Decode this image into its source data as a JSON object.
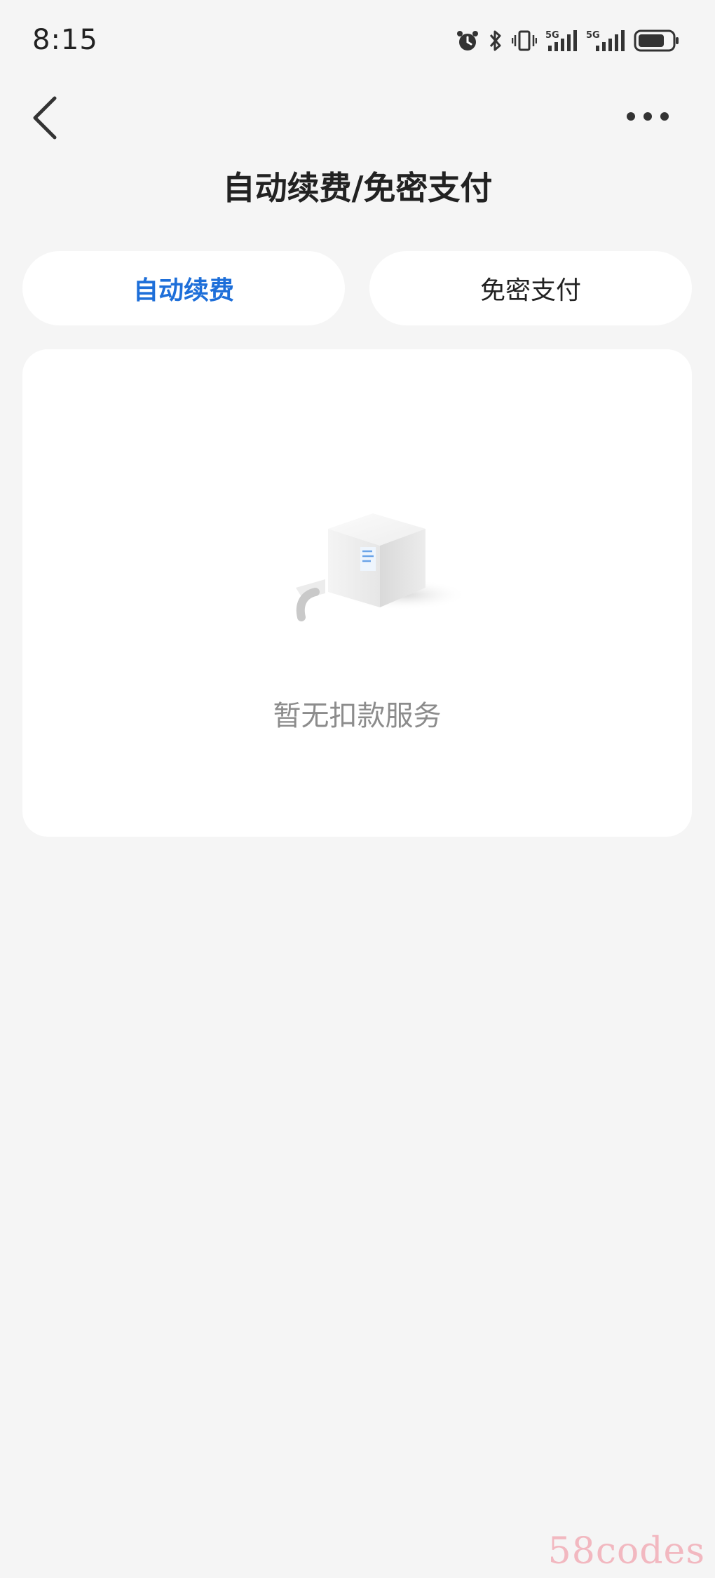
{
  "status_bar": {
    "time": "8:15",
    "icons": [
      "alarm-icon",
      "bluetooth-icon",
      "vibrate-icon",
      "signal-5g-icon",
      "signal-5g-hd-icon",
      "battery-icon"
    ],
    "signal_labels": [
      "5G",
      "5G"
    ]
  },
  "nav": {
    "back_icon": "chevron-left-icon",
    "more_icon": "more-horizontal-icon"
  },
  "page": {
    "title": "自动续费/免密支付"
  },
  "tabs": [
    {
      "label": "自动续费",
      "active": true
    },
    {
      "label": "免密支付",
      "active": false
    }
  ],
  "empty_state": {
    "icon": "empty-box-icon",
    "message": "暂无扣款服务"
  },
  "watermark": "58codes",
  "colors": {
    "accent": "#1e6fd9",
    "background": "#f5f5f5",
    "card": "#ffffff",
    "muted_text": "#8c8c8c",
    "watermark": "#f2b8c0"
  }
}
